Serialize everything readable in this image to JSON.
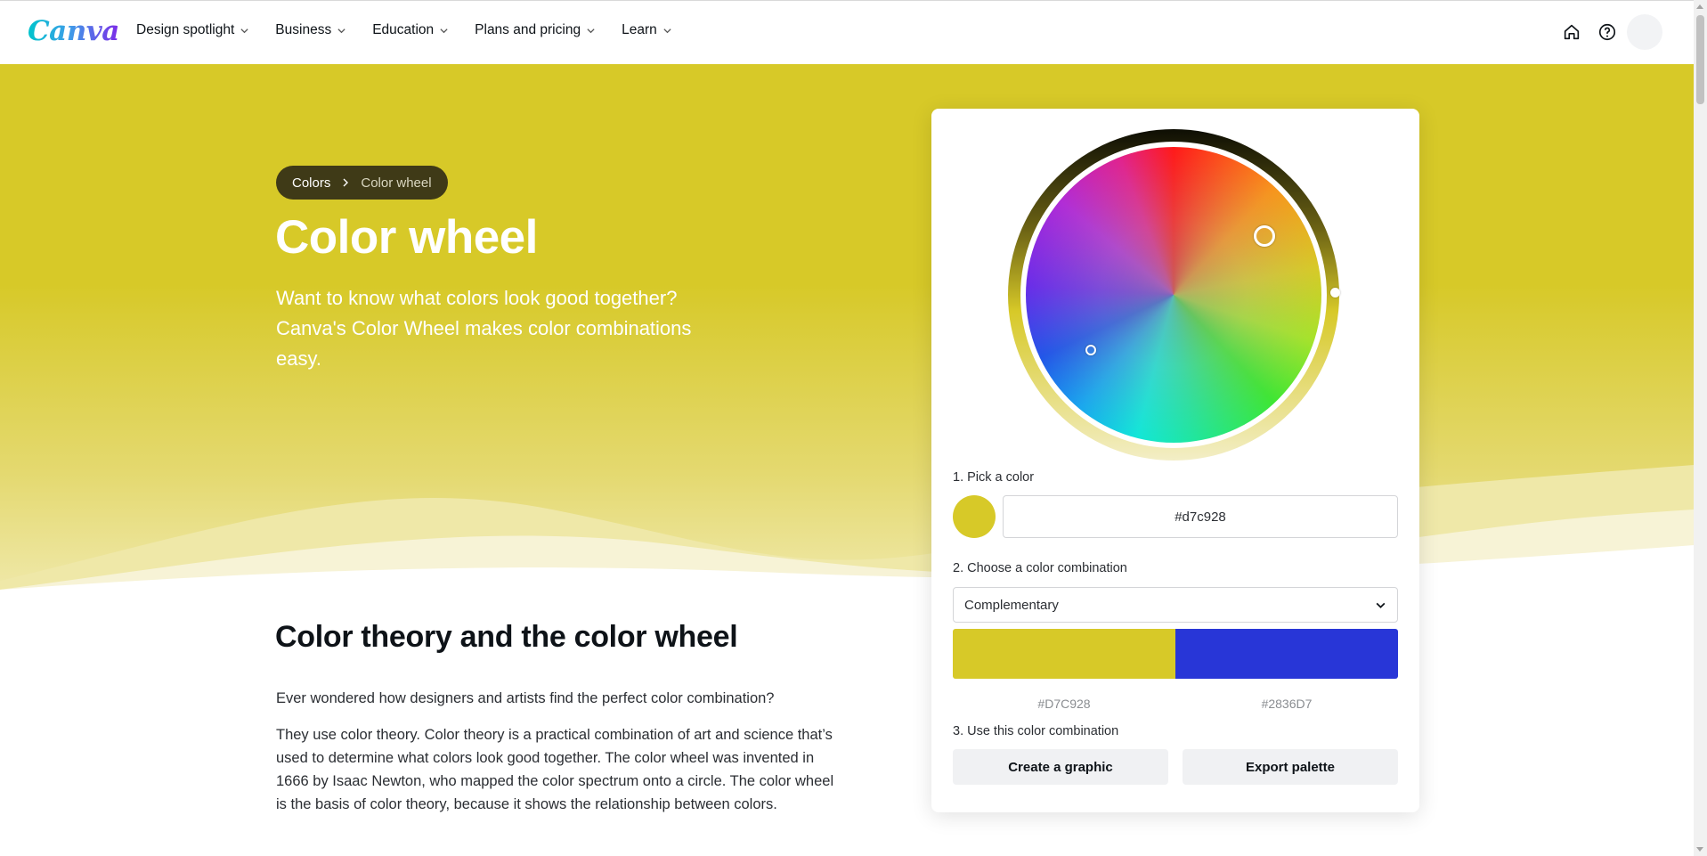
{
  "nav": {
    "logo": "Canva",
    "items": [
      {
        "label": "Design spotlight"
      },
      {
        "label": "Business"
      },
      {
        "label": "Education"
      },
      {
        "label": "Plans and pricing"
      },
      {
        "label": "Learn"
      }
    ],
    "icons": [
      "home-icon",
      "help-icon",
      "avatar"
    ]
  },
  "hero": {
    "breadcrumb": {
      "parent": "Colors",
      "current": "Color wheel"
    },
    "title": "Color wheel",
    "subtitle": "Want to know what colors look good together? Canva's Color Wheel makes color combinations easy.",
    "background_color": "#d7c928"
  },
  "content": {
    "section_title": "Color theory and the color wheel",
    "para1": "Ever wondered how designers and artists find the perfect color combination?",
    "para2": "They use color theory. Color theory is a practical combination of art and science that’s used to determine what colors look good together. The color wheel was invented in 1666 by Isaac Newton, who mapped the color spectrum onto a circle. The color wheel is the basis of color theory, because it shows the relationship between colors."
  },
  "tool": {
    "step1_label": "1. Pick a color",
    "selected_color": "#d7c928",
    "hex_value": "#d7c928",
    "step2_label": "2. Choose a color combination",
    "combination": "Complementary",
    "palette": [
      {
        "color": "#D7C928",
        "label": "#D7C928"
      },
      {
        "color": "#2836D7",
        "label": "#2836D7"
      }
    ],
    "step3_label": "3. Use this color combination",
    "create_button": "Create a graphic",
    "export_button": "Export palette"
  }
}
